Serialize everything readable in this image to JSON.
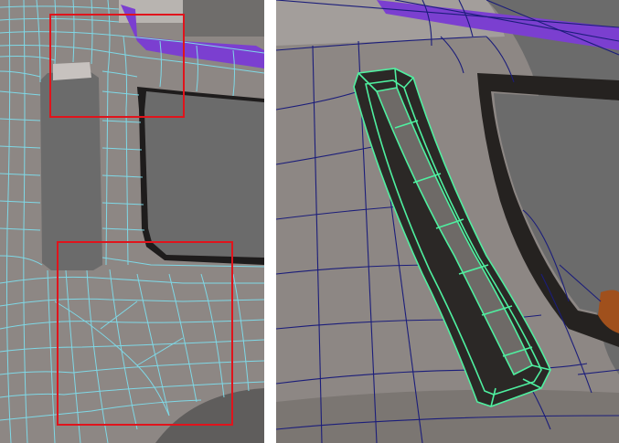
{
  "figure": {
    "panels": [
      {
        "id": "left",
        "view": "wireframe-cyan",
        "highlight_boxes": 2,
        "box_color": "#e0141c"
      },
      {
        "id": "right",
        "view": "wireframe-navy-selected-slot",
        "selection_color": "#4ff0a0"
      }
    ]
  },
  "colors": {
    "mesh_surface": "#8d8784",
    "mesh_surface_light": "#a19b98",
    "viewport_bg": "#6b6b6b",
    "cavity": "#2d2a28",
    "left_wire": "#7fd8e6",
    "right_wire": "#1b1d7a",
    "purple_panel": "#7b3fd0",
    "highlight_box": "#e0141c",
    "selection_edges": "#4ff0a0"
  }
}
